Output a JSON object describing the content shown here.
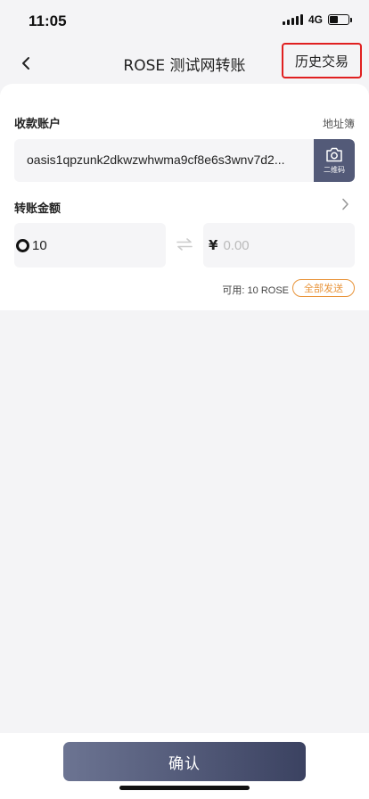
{
  "status_bar": {
    "time": "11:05",
    "network": "4G",
    "battery_level": 0.45
  },
  "nav": {
    "title": "ROSE 测试网转账",
    "history_label": "历史交易",
    "highlight_color": "#e02020"
  },
  "recipient": {
    "label": "收款账户",
    "address_book_label": "地址簿",
    "address": "oasis1qpzunk2dkwzwhwma9cf8e6s3wnv7d2...",
    "qr_label": "二维码"
  },
  "amount": {
    "label": "转账金额",
    "value": "10",
    "currency_symbol": "¥",
    "fiat_placeholder": "0.00",
    "available_text": "可用: 10 ROSE",
    "send_all_label": "全部发送"
  },
  "footer": {
    "confirm_label": "确认"
  },
  "colors": {
    "accent": "#535a78",
    "send_all": "#e8943a",
    "background": "#f4f4f6"
  }
}
